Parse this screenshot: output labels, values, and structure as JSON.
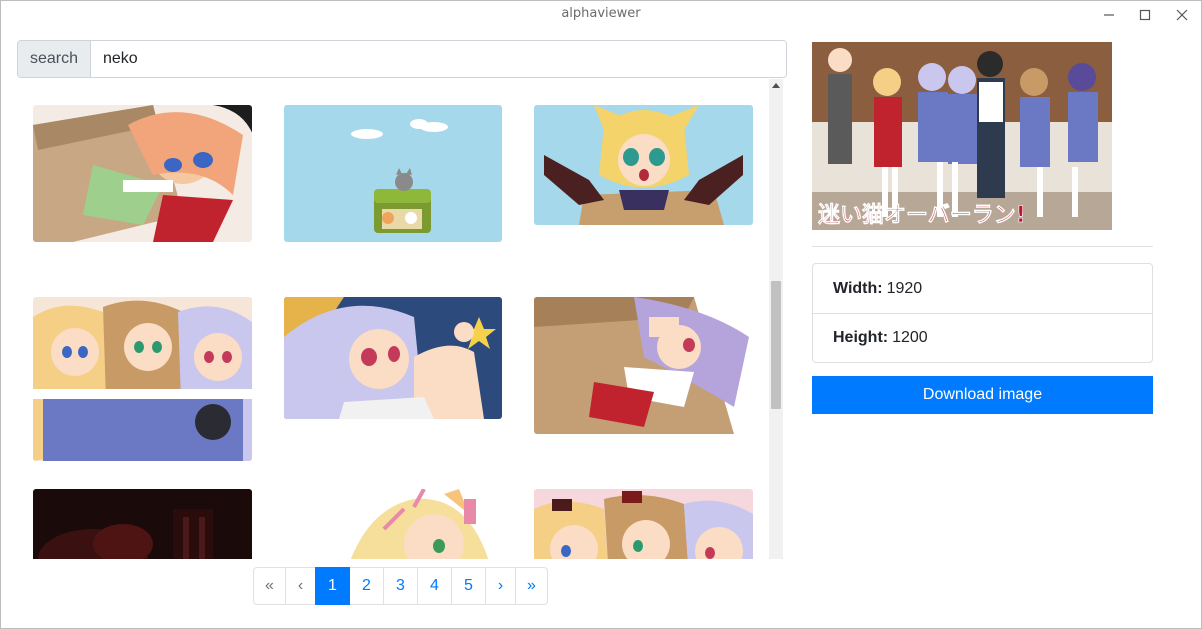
{
  "window": {
    "title": "alphaviewer",
    "icons": [
      "minimize-icon",
      "maximize-icon",
      "close-icon"
    ]
  },
  "search": {
    "label": "search",
    "value": "neko"
  },
  "gallery": {
    "thumbnails": [
      {
        "name": "thumb-1",
        "subject": "orange-hair girl in cardboard box"
      },
      {
        "name": "thumb-2",
        "subject": "cats on chest, light blue sky"
      },
      {
        "name": "thumb-3",
        "subject": "blonde cat-ear girl reaching out of box"
      },
      {
        "name": "thumb-4",
        "subject": "three girls with black cat"
      },
      {
        "name": "thumb-5",
        "subject": "lavender-hair cat girl, night sky"
      },
      {
        "name": "thumb-6",
        "subject": "purple-hair girl in cardboard box"
      },
      {
        "name": "thumb-7",
        "subject": "dark red scene"
      },
      {
        "name": "thumb-8",
        "subject": "blonde fox-ear girl winking"
      },
      {
        "name": "thumb-9",
        "subject": "three girls with ribbons"
      }
    ]
  },
  "pagination": {
    "first": "«",
    "prev": "‹",
    "pages": [
      "1",
      "2",
      "3",
      "4",
      "5"
    ],
    "active_page": "1",
    "next": "›",
    "last": "»"
  },
  "preview": {
    "caption": "迷い猫オーバーラン!"
  },
  "details": {
    "width_label": "Width:",
    "width_value": "1920",
    "height_label": "Height:",
    "height_value": "1200"
  },
  "download": {
    "label": "Download image"
  },
  "colors": {
    "accent": "#007bff",
    "sky": "#a5d8ea"
  }
}
